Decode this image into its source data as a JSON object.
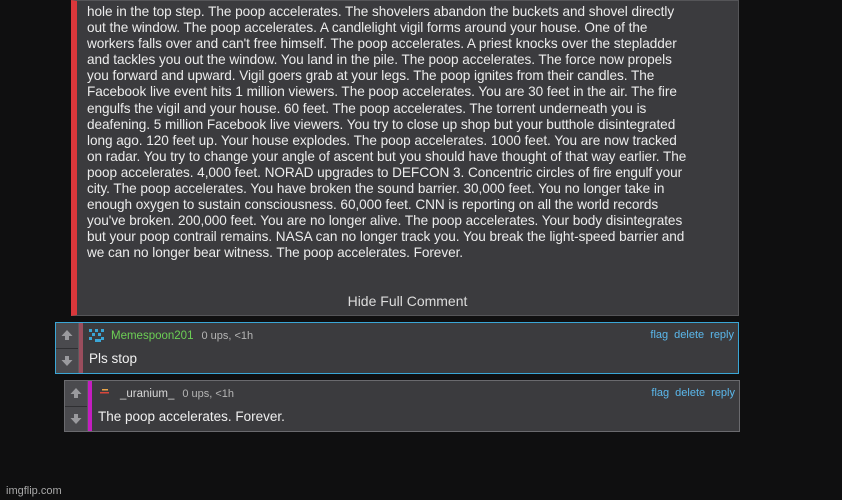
{
  "main_comment": {
    "lines": [
      "hole in the top step. The poop accelerates. The shovelers abandon the buckets and shovel directly",
      "out the window. The poop accelerates. A candlelight vigil forms around your house. One of the",
      "workers falls over and can't free himself. The poop accelerates. A priest knocks over the stepladder",
      "and tackles you out the window. You land in the pile. The poop accelerates. The force now propels",
      "you forward and upward. Vigil goers grab at your legs. The poop ignites from their candles. The",
      "Facebook live event hits 1 million viewers. The poop accelerates. You are 30 feet in the air. The fire",
      "engulfs the vigil and your house. 60 feet. The poop accelerates. The torrent underneath you is",
      "deafening. 5 million Facebook live viewers. You try to close up shop but your butthole disintegrated",
      "long ago. 120 feet up. Your house explodes. The poop accelerates. 1000 feet. You are now tracked",
      "on radar. You try to change your angle of ascent but you should have thought of that way earlier. The",
      "poop accelerates. 4,000 feet. NORAD upgrades to DEFCON 3. Concentric circles of fire engulf your",
      "city. The poop accelerates. You have broken the sound barrier. 30,000 feet. You no longer take in",
      "enough oxygen to sustain consciousness. 60,000 feet. CNN is reporting on all the world records",
      "you've broken. 200,000 feet. You are no longer alive. The poop accelerates. Your body disintegrates",
      "but your poop contrail remains. NASA can no longer track you. You break the light-speed barrier and",
      "we can no longer bear witness. The poop accelerates. Forever."
    ],
    "hide_label": "Hide Full Comment",
    "accent_color": "#d9373b"
  },
  "replies": [
    {
      "username": "Memespoon201",
      "meta": "0 ups, <1h",
      "text": "Pls stop",
      "flag": "flag",
      "delete": "delete",
      "reply": "reply",
      "username_color": "#6ccf55"
    },
    {
      "username": "_uranium_",
      "meta": "0 ups, <1h",
      "text": "The poop accelerates. Forever.",
      "flag": "flag",
      "delete": "delete",
      "reply": "reply",
      "accent_color": "#c31ec0"
    }
  ],
  "watermark": "imgflip.com",
  "icons": {
    "upvote": "arrow-up-icon",
    "downvote": "arrow-down-icon"
  }
}
